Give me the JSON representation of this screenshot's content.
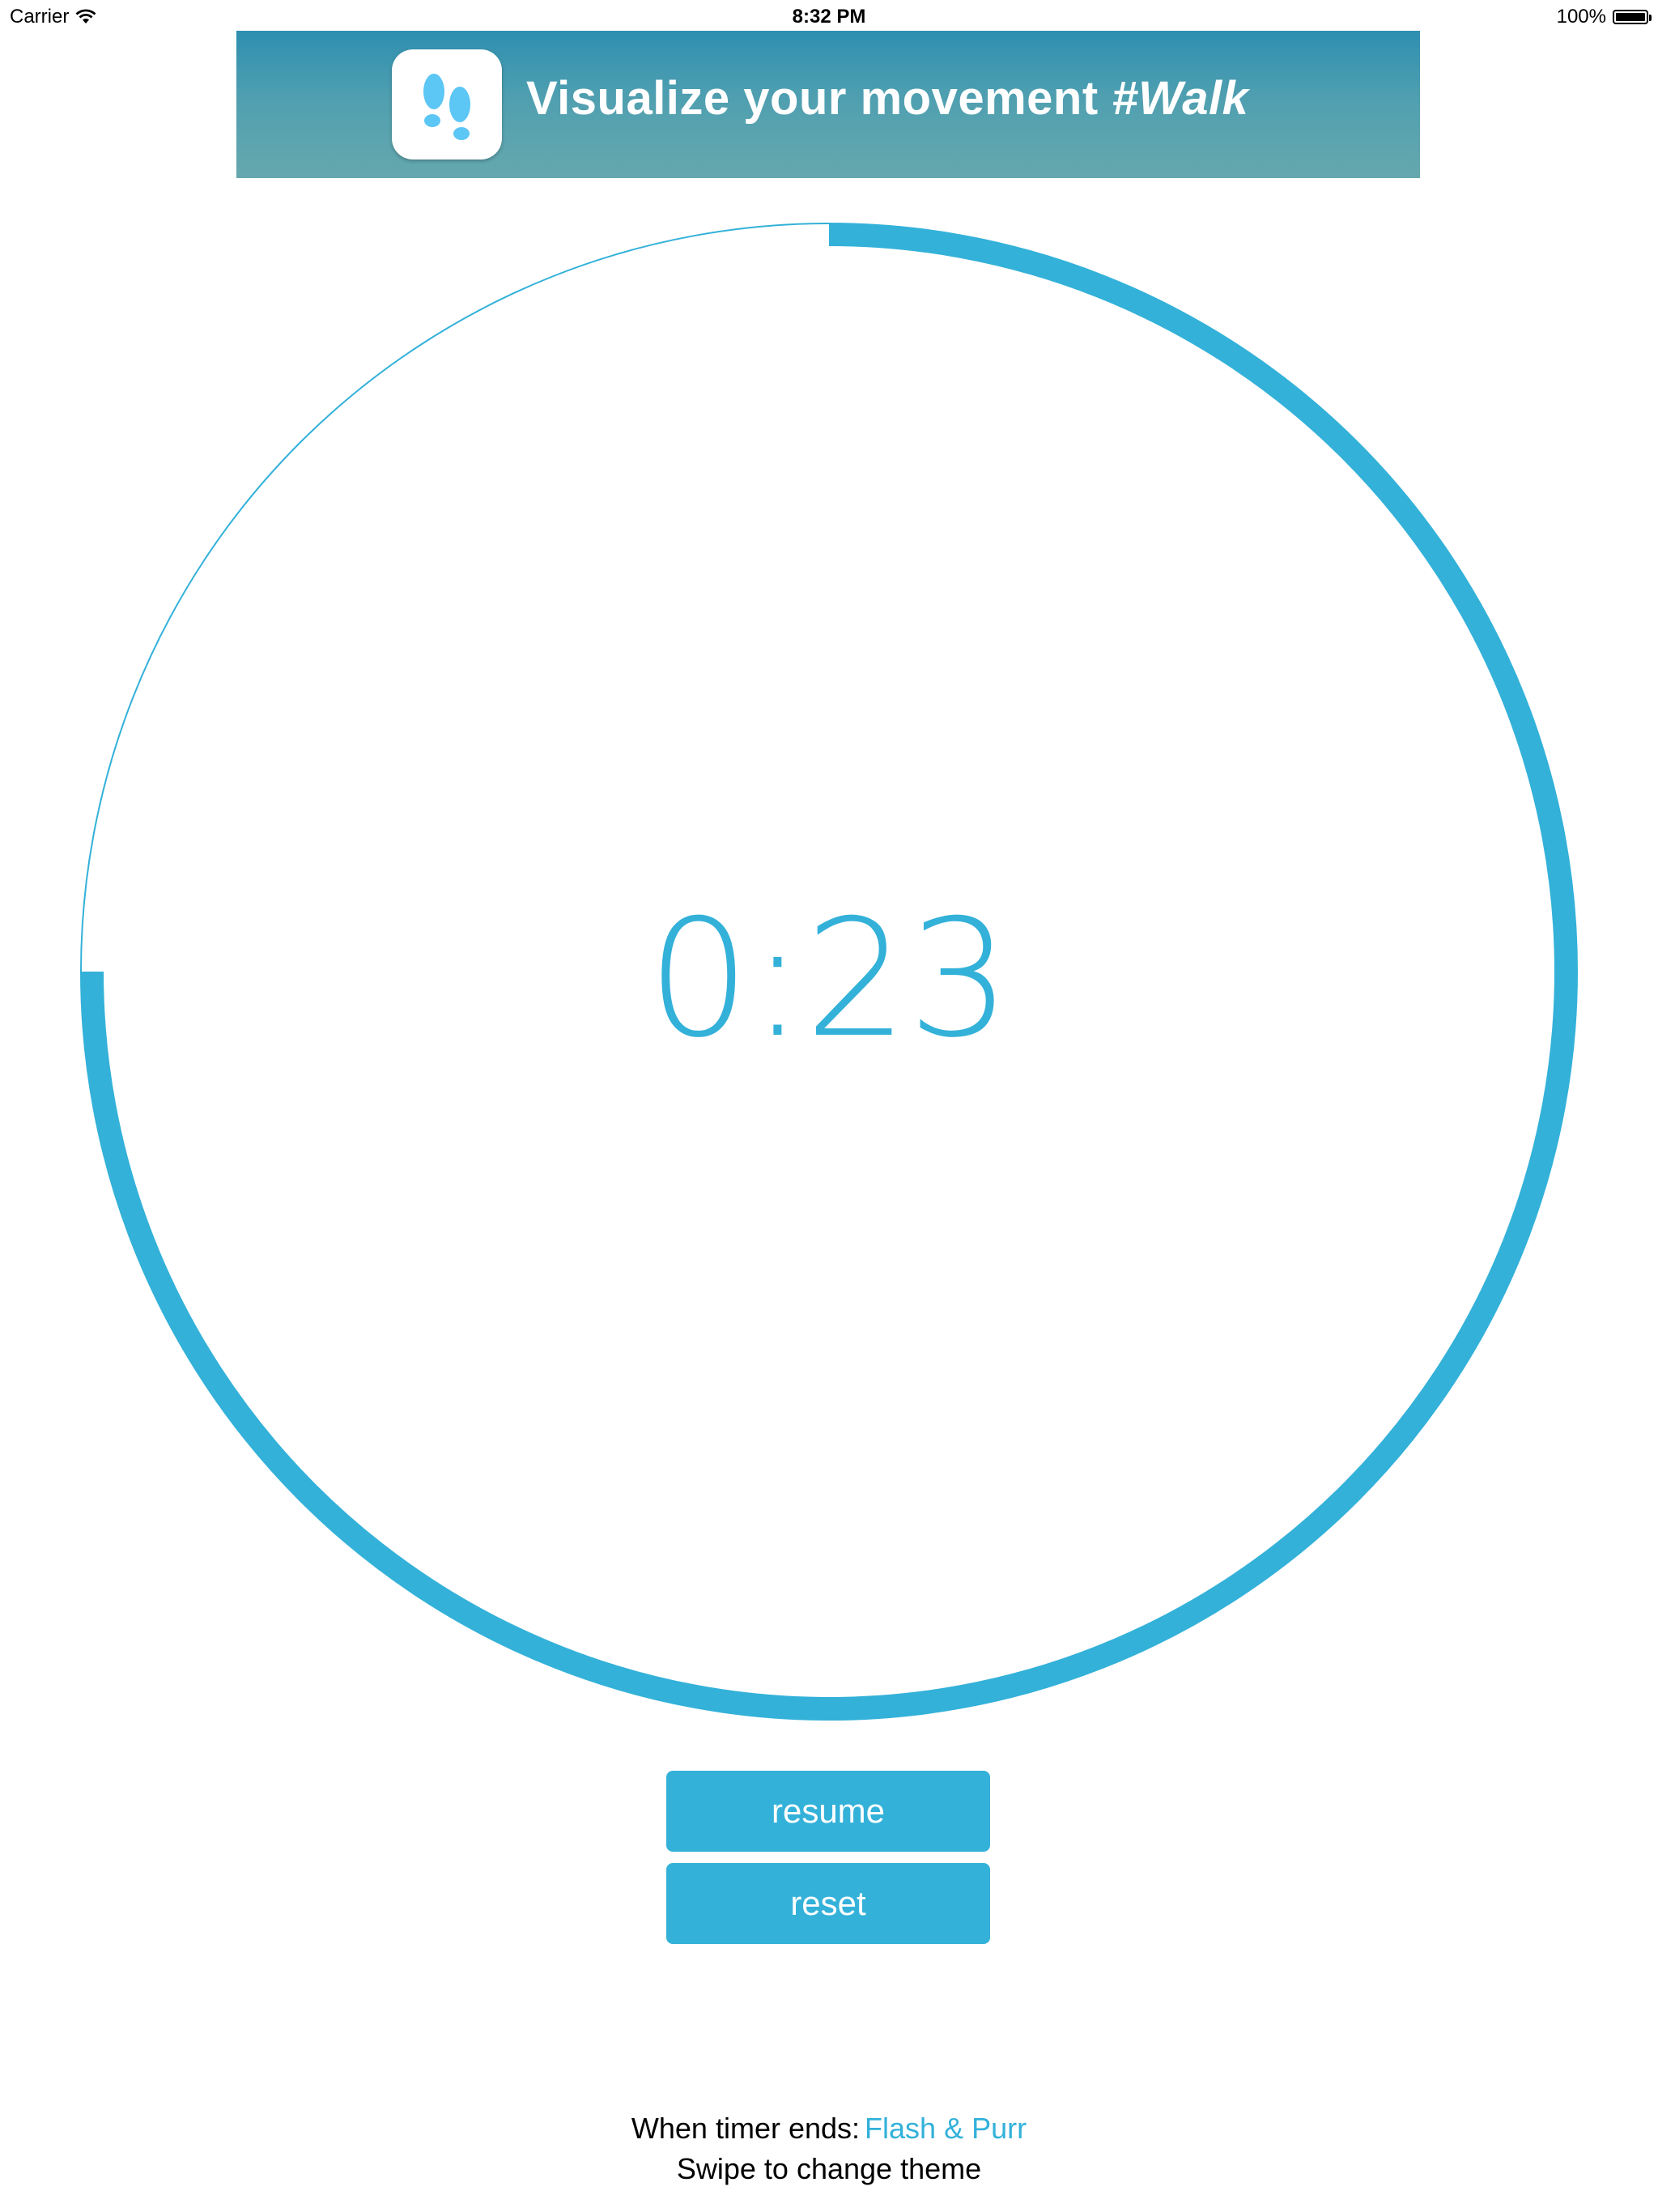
{
  "status_bar": {
    "carrier": "Carrier",
    "time": "8:32 PM",
    "battery": "100%",
    "wifi_icon": "wifi-icon",
    "battery_icon": "battery-icon"
  },
  "banner": {
    "icon": "footprints-icon",
    "text": "Visualize your movement",
    "hashtag": "#Walk"
  },
  "timer": {
    "display": "0:23",
    "progress_fraction": 0.75,
    "accent_color": "#33b1d9"
  },
  "buttons": {
    "resume_label": "resume",
    "reset_label": "reset"
  },
  "footer": {
    "timer_end_label": "When timer ends:",
    "timer_end_value": "Flash & Purr",
    "theme_hint": "Swipe to change theme"
  }
}
